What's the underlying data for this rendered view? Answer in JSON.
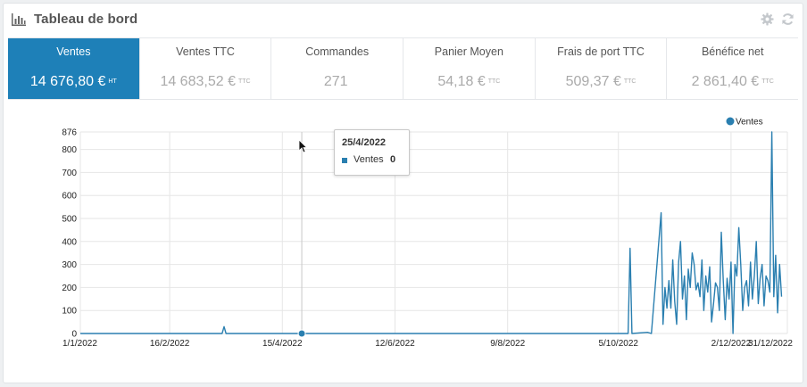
{
  "header": {
    "title": "Tableau de bord",
    "icons": [
      "bar-chart-icon",
      "gear-icon",
      "refresh-icon"
    ]
  },
  "kpis": [
    {
      "label": "Ventes",
      "value": "14 676,80 €",
      "unit": "HT",
      "active": true
    },
    {
      "label": "Ventes TTC",
      "value": "14 683,52 €",
      "unit": "TTC",
      "active": false
    },
    {
      "label": "Commandes",
      "value": "271",
      "unit": "",
      "active": false
    },
    {
      "label": "Panier Moyen",
      "value": "54,18 €",
      "unit": "TTC",
      "active": false
    },
    {
      "label": "Frais de port TTC",
      "value": "509,37 €",
      "unit": "TTC",
      "active": false
    },
    {
      "label": "Bénéfice net",
      "value": "2 861,40 €",
      "unit": "TTC",
      "active": false
    }
  ],
  "tooltip": {
    "date": "25/4/2022",
    "series": "Ventes",
    "value": "0"
  },
  "colors": {
    "accent": "#1e80b8",
    "series": "#2a7fb0",
    "grid": "#e6e6e6"
  },
  "chart_data": {
    "type": "line",
    "legend": {
      "position": "top-right"
    },
    "grid": true,
    "ylim": [
      0,
      876
    ],
    "yticks": [
      0,
      100,
      200,
      300,
      400,
      500,
      600,
      700,
      800,
      876
    ],
    "xticks": [
      "1/1/2022",
      "16/2/2022",
      "15/4/2022",
      "12/6/2022",
      "9/8/2022",
      "5/10/2022",
      "2/12/2022",
      "31/12/2022"
    ],
    "highlight": {
      "x": "25/4/2022",
      "y": 0
    },
    "series": [
      {
        "name": "Ventes",
        "points": [
          [
            "2022-01-01",
            0
          ],
          [
            "2022-03-15",
            0
          ],
          [
            "2022-03-16",
            30
          ],
          [
            "2022-03-17",
            0
          ],
          [
            "2022-10-10",
            0
          ],
          [
            "2022-10-11",
            370
          ],
          [
            "2022-10-12",
            0
          ],
          [
            "2022-10-20",
            5
          ],
          [
            "2022-10-22",
            0
          ],
          [
            "2022-10-27",
            525
          ],
          [
            "2022-10-28",
            40
          ],
          [
            "2022-10-29",
            200
          ],
          [
            "2022-10-30",
            110
          ],
          [
            "2022-10-31",
            230
          ],
          [
            "2022-11-01",
            110
          ],
          [
            "2022-11-02",
            320
          ],
          [
            "2022-11-03",
            140
          ],
          [
            "2022-11-04",
            40
          ],
          [
            "2022-11-05",
            310
          ],
          [
            "2022-11-06",
            400
          ],
          [
            "2022-11-07",
            150
          ],
          [
            "2022-11-08",
            250
          ],
          [
            "2022-11-09",
            60
          ],
          [
            "2022-11-10",
            280
          ],
          [
            "2022-11-11",
            200
          ],
          [
            "2022-11-12",
            350
          ],
          [
            "2022-11-13",
            300
          ],
          [
            "2022-11-14",
            190
          ],
          [
            "2022-11-15",
            220
          ],
          [
            "2022-11-16",
            160
          ],
          [
            "2022-11-17",
            320
          ],
          [
            "2022-11-18",
            100
          ],
          [
            "2022-11-19",
            250
          ],
          [
            "2022-11-20",
            180
          ],
          [
            "2022-11-21",
            290
          ],
          [
            "2022-11-22",
            50
          ],
          [
            "2022-11-23",
            130
          ],
          [
            "2022-11-24",
            220
          ],
          [
            "2022-11-25",
            200
          ],
          [
            "2022-11-26",
            100
          ],
          [
            "2022-11-27",
            440
          ],
          [
            "2022-11-28",
            230
          ],
          [
            "2022-11-29",
            60
          ],
          [
            "2022-11-30",
            240
          ],
          [
            "2022-12-01",
            150
          ],
          [
            "2022-12-02",
            310
          ],
          [
            "2022-12-03",
            0
          ],
          [
            "2022-12-04",
            300
          ],
          [
            "2022-12-05",
            250
          ],
          [
            "2022-12-06",
            460
          ],
          [
            "2022-12-07",
            300
          ],
          [
            "2022-12-08",
            100
          ],
          [
            "2022-12-09",
            200
          ],
          [
            "2022-12-10",
            230
          ],
          [
            "2022-12-11",
            120
          ],
          [
            "2022-12-12",
            310
          ],
          [
            "2022-12-13",
            150
          ],
          [
            "2022-12-14",
            250
          ],
          [
            "2022-12-15",
            400
          ],
          [
            "2022-12-16",
            130
          ],
          [
            "2022-12-17",
            240
          ],
          [
            "2022-12-18",
            300
          ],
          [
            "2022-12-19",
            120
          ],
          [
            "2022-12-20",
            250
          ],
          [
            "2022-12-21",
            230
          ],
          [
            "2022-12-22",
            180
          ],
          [
            "2022-12-23",
            876
          ],
          [
            "2022-12-24",
            160
          ],
          [
            "2022-12-25",
            340
          ],
          [
            "2022-12-26",
            90
          ],
          [
            "2022-12-27",
            300
          ],
          [
            "2022-12-28",
            160
          ]
        ]
      }
    ]
  }
}
